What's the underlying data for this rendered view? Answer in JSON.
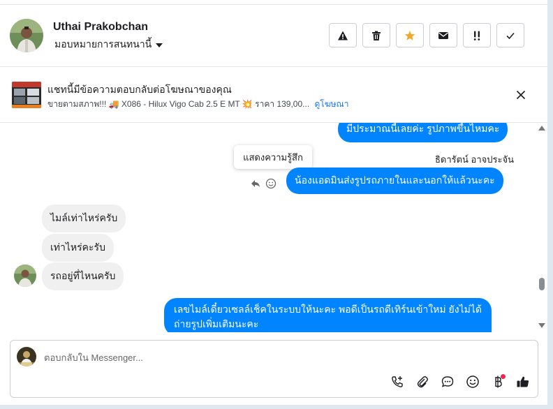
{
  "colors": {
    "accent": "#0084ff",
    "link": "#1877f2",
    "star": "#f5a623",
    "badge": "#f02849"
  },
  "header": {
    "contact_name": "Uthai Prakobchan",
    "assign_label": "มอบหมายการสนทนานี้",
    "actions": [
      {
        "icon": "warning-icon"
      },
      {
        "icon": "trash-icon"
      },
      {
        "icon": "star-icon"
      },
      {
        "icon": "envelope-icon"
      },
      {
        "icon": "follow-up-icon"
      },
      {
        "icon": "check-icon"
      }
    ]
  },
  "ad_bar": {
    "title": "แชทนี้มีข้อความตอบกลับต่อโฆษณาของคุณ",
    "summary": "ขายตามสภาพ!!! 🚚 X086 - Hilux Vigo Cab 2.5 E MT 💥 ราคา 139,00...",
    "link_label": "ดูโฆษณา"
  },
  "thread": {
    "messages": [
      {
        "direction": "out",
        "text": "มีประมาณนี้เลยค่ะ รูปภาพขึ้นไหมคะ"
      },
      {
        "direction": "out",
        "sender": "ธิดารัตน์ อาจประจัน",
        "text": "น้องแอดมินส่งรูปรถภายในและนอกให้แล้วนะคะ"
      },
      {
        "direction": "in",
        "text": "ไมล์เท่าไหร่ครับ"
      },
      {
        "direction": "in",
        "text": "เท่าไหร่คะรับ"
      },
      {
        "direction": "in",
        "text": "รถอยู่ที่ไหนครับ"
      },
      {
        "direction": "out",
        "text_line1": "เลขไมล์เดี๋ยวเซลล์เช็คในระบบให้นะคะ พอดีเป็นรถดีเทิร์นเข้าใหม่ ยังไม่ได้",
        "text_line2": "ถ่ายรูปเพิ่มเติมนะคะ"
      }
    ],
    "tooltip": "แสดงความรู้สึก"
  },
  "composer": {
    "placeholder": "ตอบกลับใน Messenger...",
    "tools": [
      "call-add-icon",
      "paperclip-icon",
      "chat-bubble-icon",
      "emoji-icon",
      "baht-icon",
      "thumbs-up-icon"
    ]
  }
}
